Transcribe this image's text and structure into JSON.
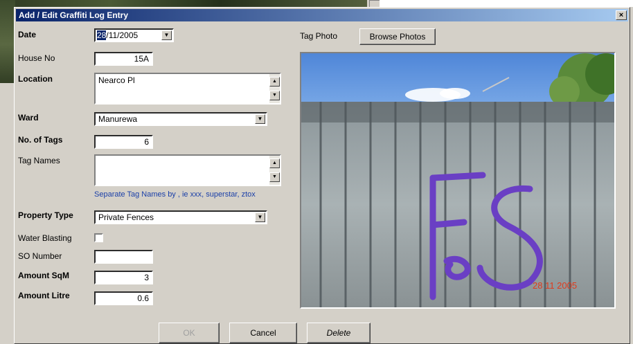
{
  "dialog": {
    "title": "Add / Edit Graffiti Log Entry",
    "close_glyph": "×"
  },
  "form": {
    "date_label": "Date",
    "date_day": "28",
    "date_rest": "/11/2005",
    "house_no_label": "House No",
    "house_no_value": "15A",
    "location_label": "Location",
    "location_value": "Nearco Pl",
    "ward_label": "Ward",
    "ward_value": "Manurewa",
    "no_tags_label": "No. of Tags",
    "no_tags_value": "6",
    "tag_names_label": "Tag Names",
    "tag_names_value": "",
    "tag_names_hint": "Separate Tag Names by , ie xxx, superstar, ztox",
    "property_type_label": "Property Type",
    "property_type_value": "Private Fences",
    "water_blasting_label": "Water Blasting",
    "water_blasting_checked": false,
    "so_number_label": "SO Number",
    "so_number_value": "",
    "amount_sqm_label": "Amount SqM",
    "amount_sqm_value": "3",
    "amount_litre_label": "Amount Litre",
    "amount_litre_value": "0.6"
  },
  "photo_panel": {
    "tag_photo_label": "Tag Photo",
    "browse_label": "Browse Photos",
    "photo_date_stamp": "28 11 2005",
    "graffiti_text": "FS"
  },
  "buttons": {
    "ok_label": "OK",
    "cancel_label": "Cancel",
    "delete_label": "Delete"
  },
  "icons": {
    "dropdown": "chevron-down-icon",
    "scroll_up": "scroll-up-icon",
    "scroll_down": "scroll-down-icon",
    "close": "close-icon"
  },
  "colors": {
    "title_bar": "#0a246a",
    "hint_text": "#1a3fa8",
    "graffiti_paint": "#6a3fc4",
    "date_stamp": "#e03a1c"
  }
}
